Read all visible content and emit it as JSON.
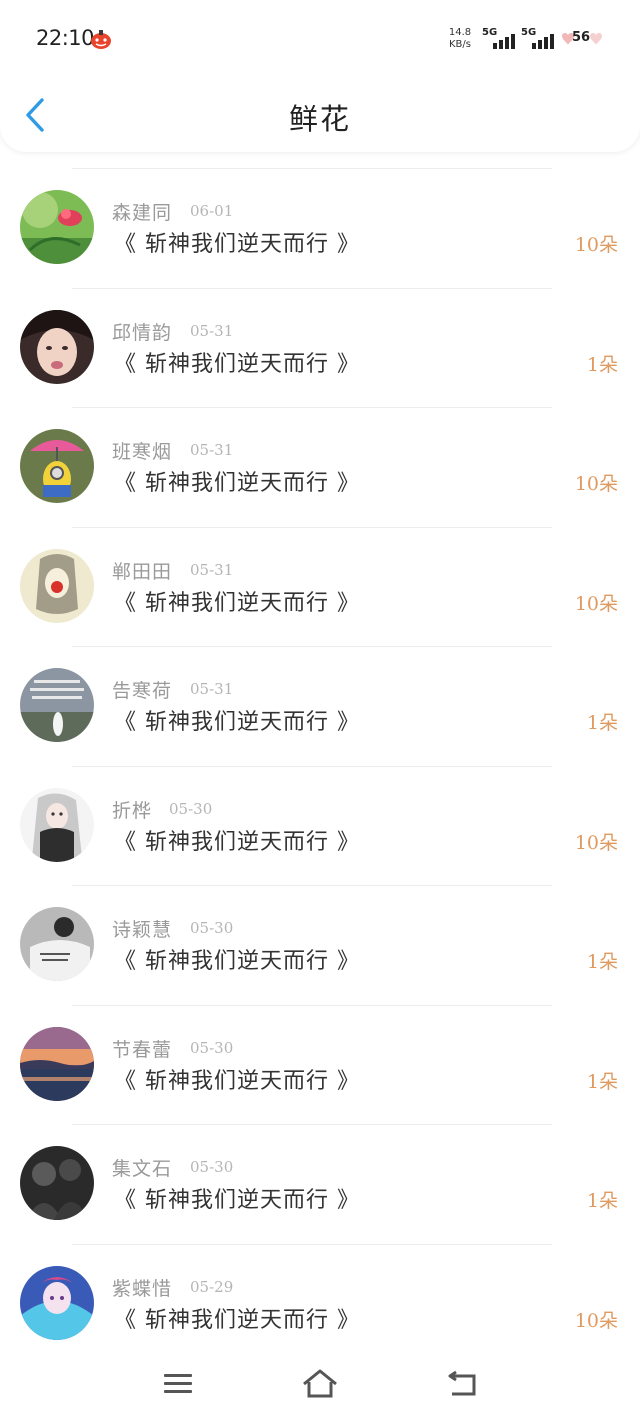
{
  "status_bar": {
    "time": "22:10",
    "net_speed_value": "14.8",
    "net_speed_unit": "KB/s",
    "signal1_label": "5G",
    "signal2_label": "5G",
    "battery_level": "56"
  },
  "header": {
    "title": "鲜花"
  },
  "items": [
    {
      "name": "森建同",
      "date": "06-01",
      "book": "《 斩神我们逆天而行 》",
      "count": "10朵"
    },
    {
      "name": "邱情韵",
      "date": "05-31",
      "book": "《 斩神我们逆天而行 》",
      "count": "1朵"
    },
    {
      "name": "班寒烟",
      "date": "05-31",
      "book": "《 斩神我们逆天而行 》",
      "count": "10朵"
    },
    {
      "name": "郸田田",
      "date": "05-31",
      "book": "《 斩神我们逆天而行 》",
      "count": "10朵"
    },
    {
      "name": "告寒荷",
      "date": "05-31",
      "book": "《 斩神我们逆天而行 》",
      "count": "1朵"
    },
    {
      "name": "折桦",
      "date": "05-30",
      "book": "《 斩神我们逆天而行 》",
      "count": "10朵"
    },
    {
      "name": "诗颖慧",
      "date": "05-30",
      "book": "《 斩神我们逆天而行 》",
      "count": "1朵"
    },
    {
      "name": "节春蕾",
      "date": "05-30",
      "book": "《 斩神我们逆天而行 》",
      "count": "1朵"
    },
    {
      "name": "集文石",
      "date": "05-30",
      "book": "《 斩神我们逆天而行 》",
      "count": "1朵"
    },
    {
      "name": "紫蝶惜",
      "date": "05-29",
      "book": "《 斩神我们逆天而行 》",
      "count": "10朵"
    }
  ],
  "colors": {
    "accent": "#2f9be6",
    "count": "#e09a60",
    "name": "#9a9a9a"
  },
  "icons": {
    "back": "chevron-left-icon",
    "menu": "menu-icon",
    "home": "home-icon",
    "return": "back-icon"
  }
}
